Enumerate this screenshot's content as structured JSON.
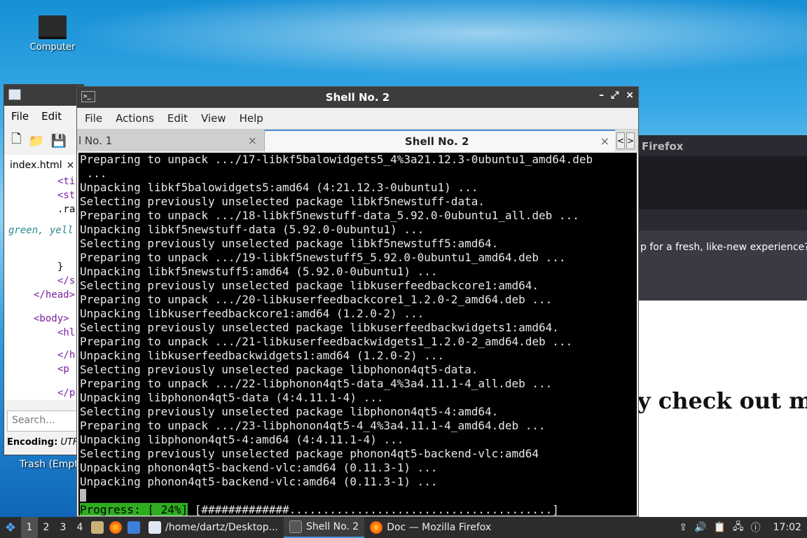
{
  "desktop": {
    "icons": [
      {
        "label": "Computer"
      }
    ],
    "trash_label": "Trash (Empt"
  },
  "editor": {
    "menu": [
      "File",
      "Edit"
    ],
    "tab_label": "index.html",
    "tab_close": "×",
    "code_lines": [
      {
        "text": "<ti",
        "class": "tag",
        "indent": 70
      },
      {
        "text": "<st",
        "class": "tag",
        "indent": 70
      },
      {
        "text": ".ra",
        "class": "",
        "indent": 70
      },
      {
        "text": "green, yell",
        "class": "italic-green",
        "indent": 0
      },
      {
        "text": "}",
        "class": "",
        "indent": 70
      },
      {
        "text": "</s",
        "class": "tag",
        "indent": 70
      },
      {
        "text": "</head>",
        "class": "tag",
        "indent": 36
      },
      {
        "text": "<body>",
        "class": "tag",
        "indent": 36
      },
      {
        "text": "<hl",
        "class": "tag",
        "indent": 70
      },
      {
        "text": "</h",
        "class": "tag",
        "indent": 70
      },
      {
        "text": "<p",
        "class": "tag",
        "indent": 70
      },
      {
        "text": "</p",
        "class": "tag",
        "indent": 70
      }
    ],
    "search_placeholder": "Search...",
    "encoding_label": "Encoding:",
    "encoding_value": "UTF"
  },
  "firefox": {
    "title": "Firefox",
    "notice": "p for a fresh, like-new experience? A",
    "heading": "y check out m"
  },
  "terminal": {
    "title": "Shell No. 2",
    "menu": [
      "File",
      "Actions",
      "Edit",
      "View",
      "Help"
    ],
    "tabs": [
      {
        "label": "l No. 1",
        "close": "×"
      },
      {
        "label": "Shell No. 2",
        "close": "×"
      }
    ],
    "scroll_left": "<",
    "scroll_right": ">",
    "window_buttons": [
      "–",
      "⤢",
      "×"
    ],
    "lines": [
      "Preparing to unpack .../17-libkf5balowidgets5_4%3a21.12.3-0ubuntu1_amd64.deb",
      " ...",
      "Unpacking libkf5balowidgets5:amd64 (4:21.12.3-0ubuntu1) ...",
      "Selecting previously unselected package libkf5newstuff-data.",
      "Preparing to unpack .../18-libkf5newstuff-data_5.92.0-0ubuntu1_all.deb ...",
      "Unpacking libkf5newstuff-data (5.92.0-0ubuntu1) ...",
      "Selecting previously unselected package libkf5newstuff5:amd64.",
      "Preparing to unpack .../19-libkf5newstuff5_5.92.0-0ubuntu1_amd64.deb ...",
      "Unpacking libkf5newstuff5:amd64 (5.92.0-0ubuntu1) ...",
      "Selecting previously unselected package libkuserfeedbackcore1:amd64.",
      "Preparing to unpack .../20-libkuserfeedbackcore1_1.2.0-2_amd64.deb ...",
      "Unpacking libkuserfeedbackcore1:amd64 (1.2.0-2) ...",
      "Selecting previously unselected package libkuserfeedbackwidgets1:amd64.",
      "Preparing to unpack .../21-libkuserfeedbackwidgets1_1.2.0-2_amd64.deb ...",
      "Unpacking libkuserfeedbackwidgets1:amd64 (1.2.0-2) ...",
      "Selecting previously unselected package libphonon4qt5-data.",
      "Preparing to unpack .../22-libphonon4qt5-data_4%3a4.11.1-4_all.deb ...",
      "Unpacking libphonon4qt5-data (4:4.11.1-4) ...",
      "Selecting previously unselected package libphonon4qt5-4:amd64.",
      "Preparing to unpack .../23-libphonon4qt5-4_4%3a4.11.1-4_amd64.deb ...",
      "Unpacking libphonon4qt5-4:amd64 (4:4.11.1-4) ...",
      "Selecting previously unselected package phonon4qt5-backend-vlc:amd64",
      "Unpacking phonon4qt5-backend-vlc:amd64 (0.11.3-1) ...",
      "Unpacking phonon4qt5-backend-vlc:amd64 (0.11.3-1) ..."
    ],
    "progress_label": "Progress: [ 24%]",
    "progress_bar": " [#############.......................................]",
    "progress_percent": 24
  },
  "taskbar": {
    "workspaces": [
      "1",
      "2",
      "3",
      "4"
    ],
    "active_workspace": "1",
    "tasks": [
      {
        "label": "/home/dartz/Desktop...",
        "active": false
      },
      {
        "label": "Shell No. 2",
        "active": true
      },
      {
        "label": "Doc — Mozilla Firefox",
        "active": false
      }
    ],
    "clock": "17:02"
  },
  "colors": {
    "progress_green": "#2eae1f",
    "terminal_bg": "#000000",
    "titlebar_bg": "#3c3c3c",
    "taskbar_bg": "#2c2c2c",
    "accent_blue": "#4a90d9"
  }
}
